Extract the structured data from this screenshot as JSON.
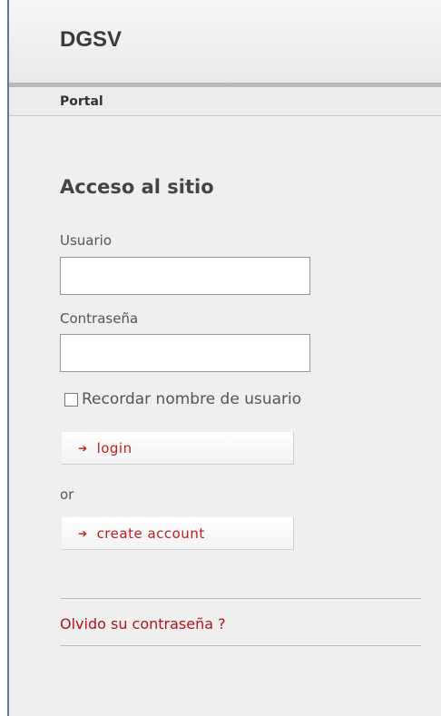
{
  "header": {
    "site_title": "DGSV"
  },
  "breadcrumb": {
    "label": "Portal"
  },
  "login": {
    "title": "Acceso al sitio",
    "username_label": "Usuario",
    "username_value": "",
    "password_label": "Contraseña",
    "password_value": "",
    "remember_label": "Recordar nombre de usuario",
    "remember_checked": false,
    "login_button": "login",
    "or_text": "or",
    "create_account_button": "create account",
    "forgot_link": "Olvido su contraseña ?"
  },
  "colors": {
    "accent_red": "#c41a1a",
    "frame_border": "#5a7aa5",
    "panel_bg": "#efefef"
  },
  "icons": {
    "button_bullet": "red-arrow-bullet-icon"
  }
}
